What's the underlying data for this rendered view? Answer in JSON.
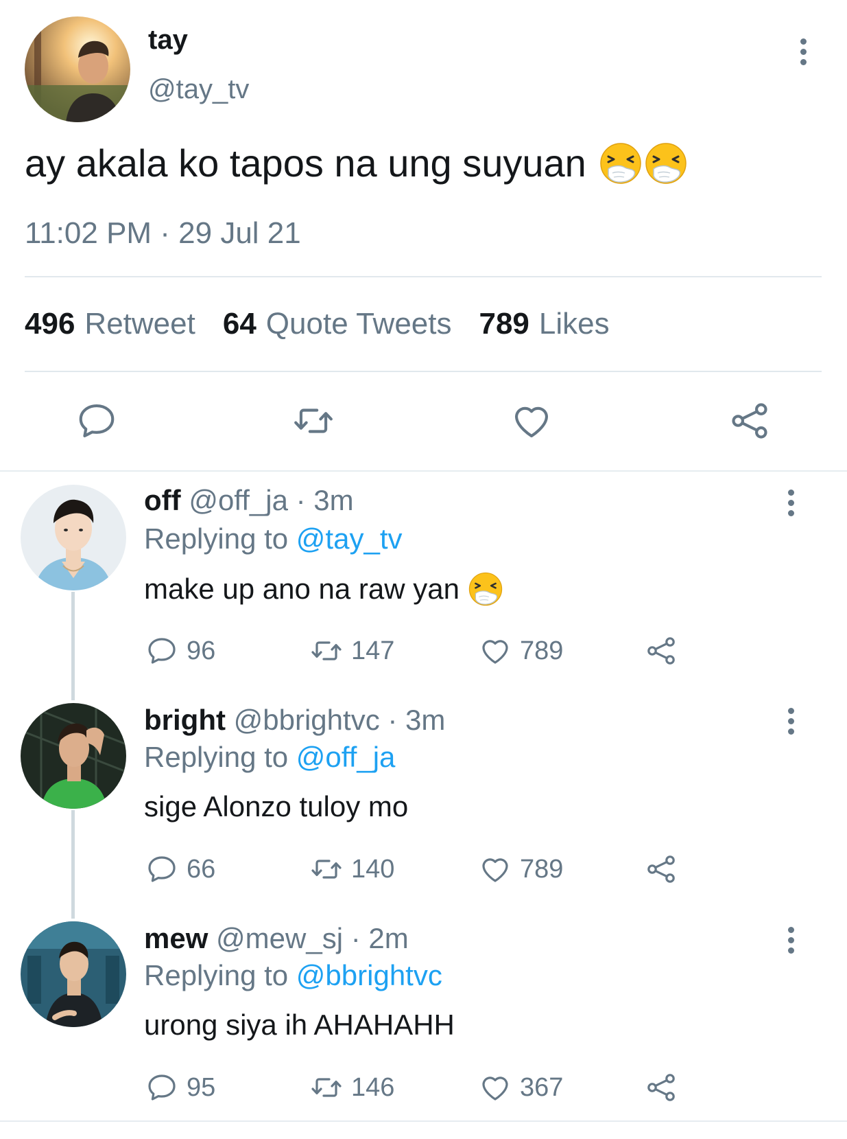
{
  "main_tweet": {
    "display_name": "tay",
    "handle": "@tay_tv",
    "text": "ay akala ko tapos na ung suyuan",
    "emoji": [
      "sneezing-face",
      "sneezing-face"
    ],
    "timestamp": "11:02 PM · 29 Jul 21",
    "stats": {
      "retweet_count": "496",
      "retweet_label": "Retweet",
      "quote_count": "64",
      "quote_label": "Quote Tweets",
      "likes_count": "789",
      "likes_label": "Likes"
    },
    "actions": [
      "reply-icon",
      "retweet-icon",
      "heart-icon",
      "share-icon"
    ]
  },
  "replies": [
    {
      "display_name": "off",
      "meta": "@off_ja · 3m",
      "replying_label": "Replying to",
      "replying_to": "@tay_tv",
      "text": "make up ano na raw yan",
      "emoji": "sneezing-face",
      "reply_count": "96",
      "retweet_count": "147",
      "like_count": "789"
    },
    {
      "display_name": "bright",
      "meta": "@bbrightvc · 3m",
      "replying_label": "Replying to",
      "replying_to": "@off_ja",
      "text": "sige Alonzo tuloy mo",
      "reply_count": "66",
      "retweet_count": "140",
      "like_count": "789"
    },
    {
      "display_name": "mew",
      "meta": "@mew_sj · 2m",
      "replying_label": "Replying to",
      "replying_to": "@bbrightvc",
      "text": "urong siya ih AHAHAHH",
      "reply_count": "95",
      "retweet_count": "146",
      "like_count": "367"
    }
  ],
  "colors": {
    "text_primary": "#14171a",
    "text_secondary": "#657786",
    "accent": "#1da1f2",
    "divider": "#e1e8ed"
  }
}
